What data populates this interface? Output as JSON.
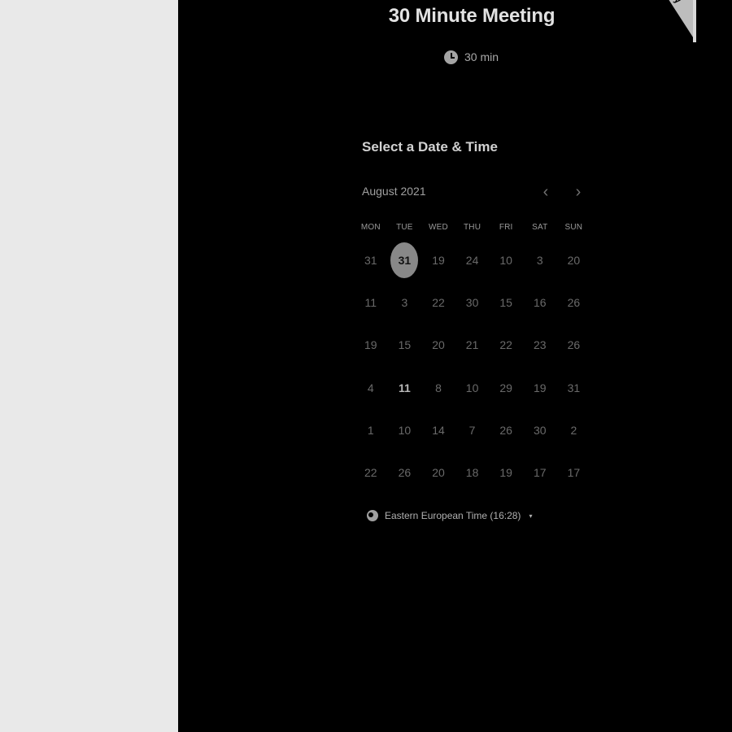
{
  "event": {
    "title": "30 Minute Meeting",
    "duration": "30 min",
    "clock_icon": "clock-icon"
  },
  "ribbon": {
    "text": "by"
  },
  "calendar": {
    "heading": "Select a Date & Time",
    "month": "August 2021",
    "prev_icon": "chevron-left-icon",
    "next_icon": "chevron-right-icon",
    "weekdays": [
      "MON",
      "TUE",
      "WED",
      "THU",
      "FRI",
      "SAT",
      "SUN"
    ],
    "weeks": [
      [
        "31",
        "31",
        "19",
        "24",
        "10",
        "3",
        "20"
      ],
      [
        "11",
        "3",
        "22",
        "30",
        "15",
        "16",
        "26"
      ],
      [
        "19",
        "15",
        "20",
        "21",
        "22",
        "23",
        "26"
      ],
      [
        "4",
        "11",
        "8",
        "10",
        "29",
        "19",
        "31"
      ],
      [
        "1",
        "10",
        "14",
        "7",
        "26",
        "30",
        "2"
      ],
      [
        "22",
        "26",
        "20",
        "18",
        "19",
        "17",
        "17"
      ]
    ],
    "selected": "31",
    "highlighted": "11"
  },
  "timezone": {
    "label": "Eastern European Time (16:28)",
    "globe_icon": "globe-icon",
    "caret": "▾"
  },
  "colors": {
    "left_pane": "#e9e9e9",
    "background": "#000000",
    "selected_day": "#888888"
  }
}
